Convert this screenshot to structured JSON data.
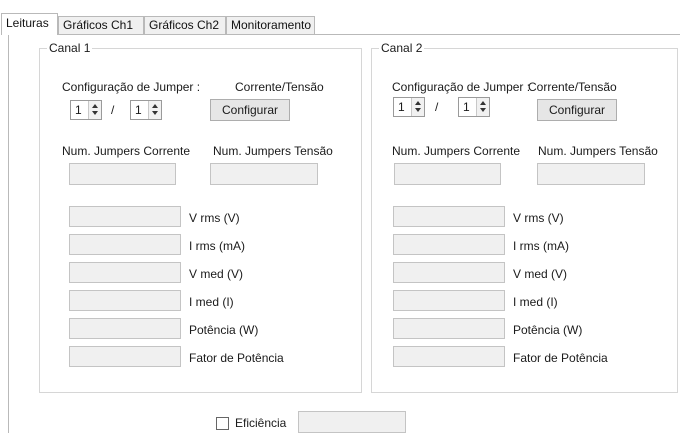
{
  "tabs": [
    {
      "label": "Leituras",
      "active": true
    },
    {
      "label": "Gráficos Ch1",
      "active": false
    },
    {
      "label": "Gráficos Ch2",
      "active": false
    },
    {
      "label": "Monitoramento",
      "active": false
    }
  ],
  "channels": [
    {
      "title": "Canal 1",
      "jumper_config_label": "Configuração de Jumper :",
      "jumper_mode": "Corrente/Tensão",
      "spinner_a": "1",
      "separator": "/",
      "spinner_b": "1",
      "configure_button": "Configurar",
      "jumpers_current_label": "Num. Jumpers Corrente",
      "jumpers_voltage_label": "Num. Jumpers Tensão",
      "readings": [
        "V rms (V)",
        "I rms (mA)",
        "V med (V)",
        "I med (I)",
        "Potência (W)",
        "Fator de Potência"
      ]
    },
    {
      "title": "Canal 2",
      "jumper_config_label": "Configuração de Jumper :",
      "jumper_mode": "Corrente/Tensão",
      "spinner_a": "1",
      "separator": "/",
      "spinner_b": "1",
      "configure_button": "Configurar",
      "jumpers_current_label": "Num. Jumpers Corrente",
      "jumpers_voltage_label": "Num. Jumpers Tensão",
      "readings": [
        "V rms (V)",
        "I rms (mA)",
        "V med (V)",
        "I med (I)",
        "Potência (W)",
        "Fator de Potência"
      ]
    }
  ],
  "efficiency": {
    "label": "Eficiência",
    "checked": false
  }
}
